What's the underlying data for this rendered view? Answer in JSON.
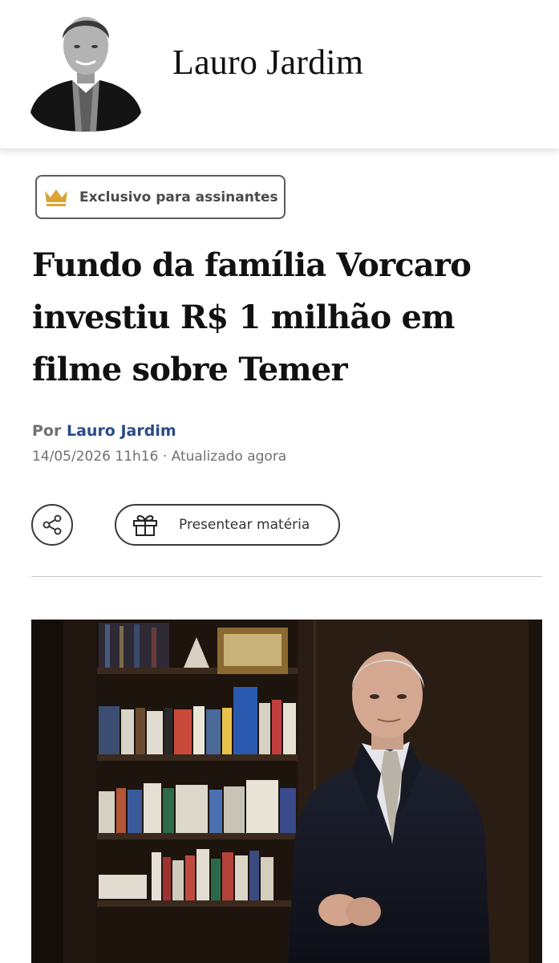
{
  "header": {
    "column_name": "Lauro Jardim"
  },
  "article": {
    "badge_label": "Exclusivo para assinantes",
    "headline": "Fundo da família Vorcaro investiu R$ 1 milhão em filme sobre Temer",
    "byline_prefix": "Por",
    "author_name": "Lauro Jardim",
    "dateline": "14/05/2026 11h16 · Atualizado agora"
  },
  "actions": {
    "share_icon": "share-icon",
    "gift_icon": "gift-icon",
    "gift_label": "Presentear matéria"
  },
  "colors": {
    "crown": "#d9a431",
    "author_link": "#2a4a8a",
    "meta_gray": "#707070"
  }
}
